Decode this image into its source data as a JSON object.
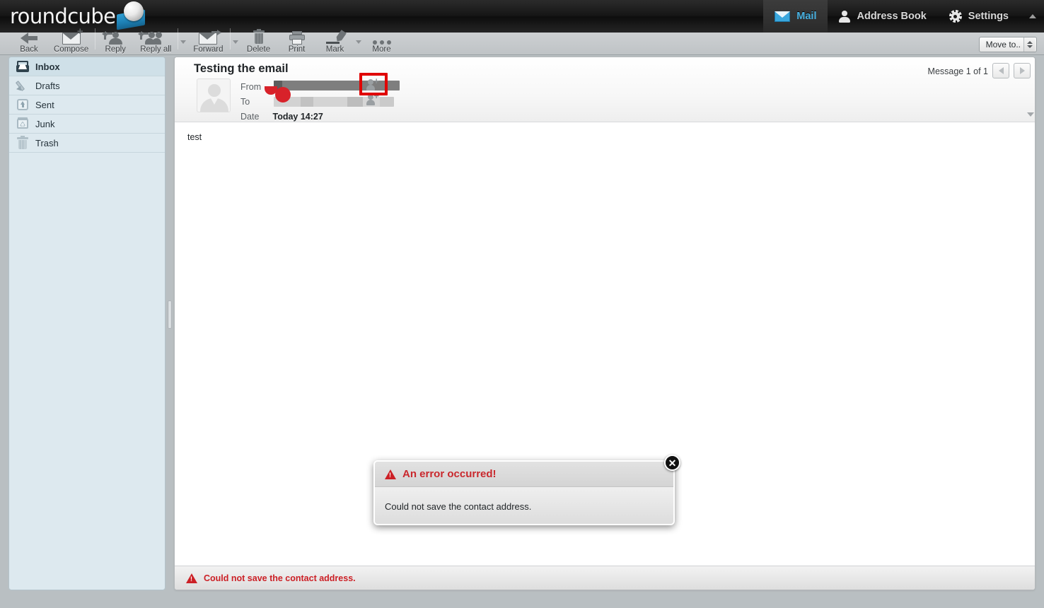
{
  "app": {
    "brand": "roundcube",
    "logo_icon": "roundcube-cube-logo"
  },
  "taskbar": {
    "items": [
      {
        "label": "Mail",
        "icon": "mail-envelope-icon",
        "selected": true
      },
      {
        "label": "Address Book",
        "icon": "person-icon",
        "selected": false
      },
      {
        "label": "Settings",
        "icon": "gear-icon",
        "selected": false
      }
    ],
    "collapse_icon": "chevron-up-icon"
  },
  "toolbar": {
    "buttons": [
      {
        "label": "Back",
        "icon": "arrow-left-icon",
        "has_caret": false
      },
      {
        "label": "Compose",
        "icon": "envelope-plus-icon",
        "has_caret": false
      },
      {
        "label": "Reply",
        "icon": "reply-person-icon",
        "has_caret": false
      },
      {
        "label": "Reply all",
        "icon": "reply-all-people-icon",
        "has_caret": true
      },
      {
        "label": "Forward",
        "icon": "forward-envelope-arrow-icon",
        "has_caret": true
      },
      {
        "label": "Delete",
        "icon": "trash-icon",
        "has_caret": false
      },
      {
        "label": "Print",
        "icon": "printer-icon",
        "has_caret": false
      },
      {
        "label": "Mark",
        "icon": "marker-pen-icon",
        "has_caret": true
      },
      {
        "label": "More",
        "icon": "ellipsis-icon",
        "has_caret": false
      }
    ],
    "move_to": {
      "label": "Move to..",
      "spinner_icon": "up-down-arrows-icon"
    }
  },
  "sidebar": {
    "folders": [
      {
        "label": "Inbox",
        "icon": "inbox-tray-icon",
        "selected": true
      },
      {
        "label": "Drafts",
        "icon": "pencil-icon",
        "selected": false
      },
      {
        "label": "Sent",
        "icon": "sent-upload-icon",
        "selected": false
      },
      {
        "label": "Junk",
        "icon": "junk-recycle-icon",
        "selected": false
      },
      {
        "label": "Trash",
        "icon": "trash-can-icon",
        "selected": false
      }
    ]
  },
  "message": {
    "subject": "Testing the email",
    "counter": "Message 1 of 1",
    "prev_icon": "triangle-left-icon",
    "next_icon": "triangle-right-icon",
    "avatar_icon": "contact-photo-placeholder",
    "expand_icon": "chevron-down-icon",
    "fields": {
      "from_label": "From",
      "from_value": "",
      "to_label": "To",
      "to_value": "",
      "date_label": "Date",
      "date_value": "Today 14:27"
    },
    "add_contact_icon": "add-contact-person-plus-icon",
    "body_text": "test"
  },
  "annotation": {
    "highlight_color": "#e00000",
    "target": "add-contact-button-from-row"
  },
  "error_dialog": {
    "title": "An error occurred!",
    "title_icon": "warning-triangle-icon",
    "message": "Could not save the contact address.",
    "close_icon": "close-x-icon",
    "title_color": "#c9282d"
  },
  "statusbar": {
    "icon": "warning-triangle-icon",
    "text": "Could not save the contact address.",
    "color": "#cc2026"
  }
}
